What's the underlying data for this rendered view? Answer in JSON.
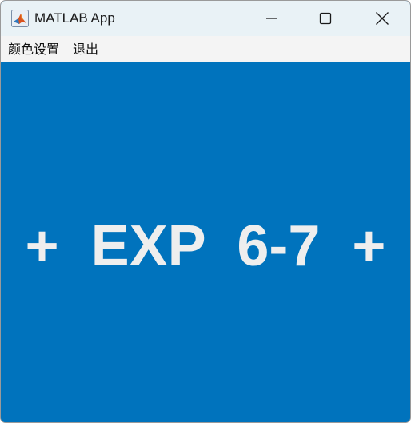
{
  "window": {
    "title": "MATLAB App",
    "controls": {
      "minimize_icon": "minimize-icon",
      "maximize_icon": "maximize-icon",
      "close_icon": "close-icon"
    }
  },
  "menu": {
    "items": [
      {
        "label": "颜色设置"
      },
      {
        "label": "退出"
      }
    ]
  },
  "main": {
    "banner_text": "+  EXP  6-7  +",
    "background_color": "#0073bd",
    "text_color": "#eeeeee"
  }
}
